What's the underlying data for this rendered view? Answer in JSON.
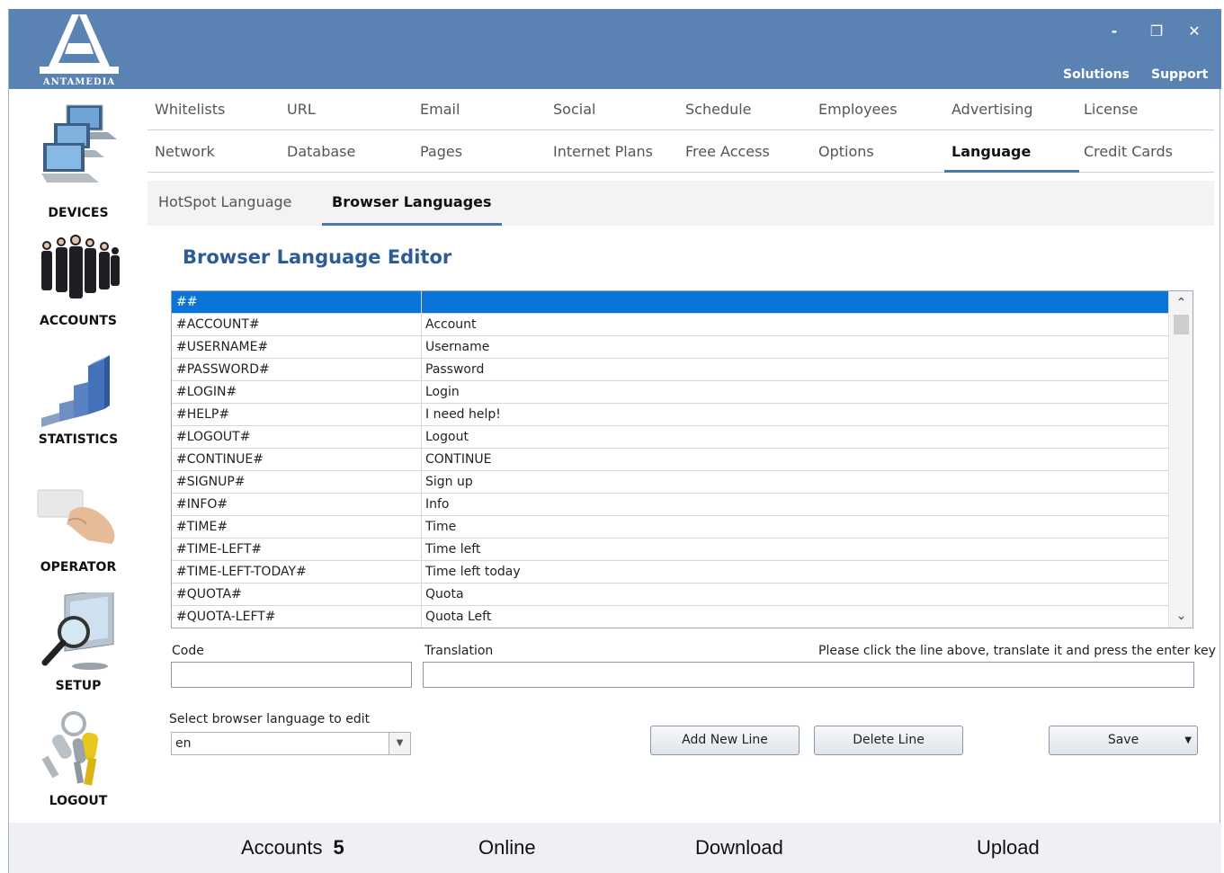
{
  "window": {
    "logo_text": "ANTAMEDIA",
    "minimize": "-",
    "restore": "❐",
    "close": "✕",
    "links": {
      "solutions": "Solutions",
      "support": "Support"
    }
  },
  "sidebar": {
    "devices": "DEVICES",
    "accounts": "ACCOUNTS",
    "statistics": "STATISTICS",
    "operator": "OPERATOR",
    "setup": "SETUP",
    "logout": "LOGOUT"
  },
  "tabs": {
    "row1": [
      "Whitelists",
      "URL",
      "Email",
      "Social",
      "Schedule",
      "Employees",
      "Advertising",
      "License"
    ],
    "row2": [
      "Network",
      "Database",
      "Pages",
      "Internet Plans",
      "Free Access",
      "Options",
      "Language",
      "Credit Cards"
    ],
    "active": "Language"
  },
  "subtabs": {
    "hotspot": "HotSpot Language",
    "browser": "Browser Languages",
    "active": "Browser Languages"
  },
  "editor": {
    "title": "Browser Language Editor",
    "rows": [
      {
        "code": "##",
        "translation": ""
      },
      {
        "code": "#ACCOUNT#",
        "translation": "Account"
      },
      {
        "code": "#USERNAME#",
        "translation": "Username"
      },
      {
        "code": "#PASSWORD#",
        "translation": "Password"
      },
      {
        "code": "#LOGIN#",
        "translation": "Login"
      },
      {
        "code": "#HELP#",
        "translation": "I need help!"
      },
      {
        "code": "#LOGOUT#",
        "translation": "Logout"
      },
      {
        "code": "#CONTINUE#",
        "translation": "CONTINUE"
      },
      {
        "code": "#SIGNUP#",
        "translation": "Sign up"
      },
      {
        "code": "#INFO#",
        "translation": "Info"
      },
      {
        "code": "#TIME#",
        "translation": "Time"
      },
      {
        "code": "#TIME-LEFT#",
        "translation": "Time left"
      },
      {
        "code": "#TIME-LEFT-TODAY#",
        "translation": "Time left today"
      },
      {
        "code": "#QUOTA#",
        "translation": "Quota"
      },
      {
        "code": "#QUOTA-LEFT#",
        "translation": "Quota Left"
      }
    ],
    "code_label": "Code",
    "code_value": "",
    "translation_label": "Translation",
    "translation_value": "",
    "hint": "Please click the line above, translate it and press the enter key",
    "select_label": "Select browser language to edit",
    "select_value": "en",
    "add_button": "Add New Line",
    "delete_button": "Delete Line",
    "save_button": "Save"
  },
  "status": {
    "accounts_label": "Accounts",
    "accounts_value": "5",
    "online_label": "Online",
    "download_label": "Download",
    "upload_label": "Upload"
  },
  "colors": {
    "titlebar": "#5a82b2",
    "accent": "#4a76ae",
    "title_text": "#2d5b97",
    "selection": "#0a74d8"
  }
}
